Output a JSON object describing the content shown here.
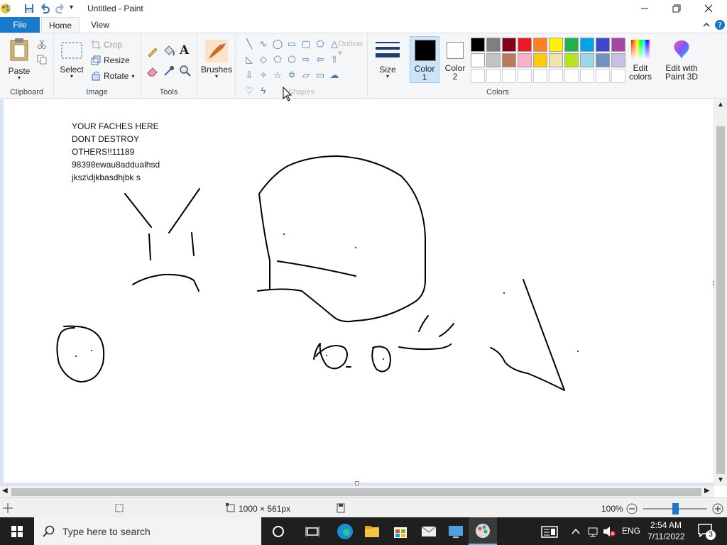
{
  "window": {
    "title": "Untitled - Paint"
  },
  "tabs": {
    "file": "File",
    "home": "Home",
    "view": "View"
  },
  "ribbon": {
    "clipboard": {
      "paste": "Paste",
      "label": "Clipboard"
    },
    "image": {
      "select": "Select",
      "crop": "Crop",
      "resize": "Resize",
      "rotate": "Rotate",
      "label": "Image"
    },
    "tools": {
      "label": "Tools",
      "text_tool": "A"
    },
    "brushes": {
      "label": "Brushes"
    },
    "shapes": {
      "outline": "Outline",
      "label": "Shapes"
    },
    "size": {
      "label": "Size"
    },
    "color1": {
      "label1": "Color",
      "label2": "1",
      "value": "#000000"
    },
    "color2": {
      "label1": "Color",
      "label2": "2",
      "value": "#ffffff"
    },
    "colors": {
      "label": "Colors",
      "palette_row1": [
        "#000000",
        "#7f7f7f",
        "#880015",
        "#ed1c24",
        "#ff7f27",
        "#fff200",
        "#22b14c",
        "#00a2e8",
        "#3f48cc",
        "#a349a4"
      ],
      "palette_row2": [
        "#ffffff",
        "#c3c3c3",
        "#b97a57",
        "#ffaec9",
        "#ffc90e",
        "#efe4b0",
        "#b5e61d",
        "#99d9ea",
        "#7092be",
        "#c8bfe7"
      ],
      "edit_colors_1": "Edit",
      "edit_colors_2": "colors"
    },
    "paint3d": {
      "label1": "Edit with",
      "label2": "Paint 3D"
    }
  },
  "canvas_notes": [
    "YOUR FACHES HERE",
    "DONT DESTROY",
    "OTHERS!!11189",
    "98398ewau8addualhsd",
    "jksz\\djkbasdhjbk s"
  ],
  "status": {
    "size": "1000 × 561px",
    "zoom": "100%",
    "zoom_level": 0.5
  },
  "taskbar": {
    "search_placeholder": "Type here to search",
    "lang": "ENG",
    "time": "2:54 AM",
    "date": "7/11/2022",
    "notifications": "3"
  }
}
